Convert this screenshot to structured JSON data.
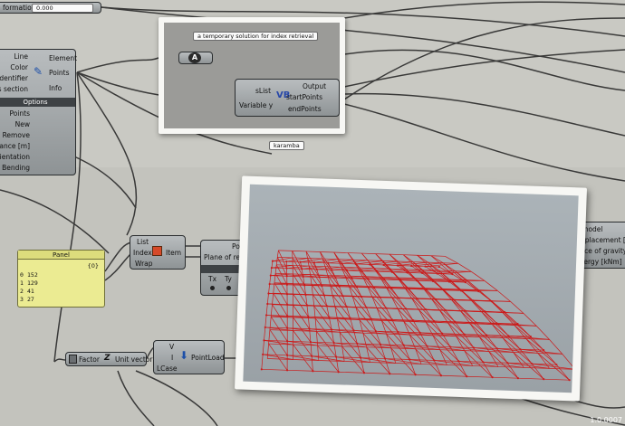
{
  "colors": {
    "canvas": "#c9c9c3",
    "component": "#9a9ea0",
    "panel": "#ebeb92",
    "truss": "#cc1a1a"
  },
  "top_left": {
    "label_cut": "formation",
    "slider_value": "0.000"
  },
  "beam_component": {
    "inputs": [
      "Line",
      "Color",
      "Identifier",
      "oss section"
    ],
    "outputs": [
      "Element",
      "Points",
      "Info"
    ],
    "icon": "pen-icon",
    "options_header": "Options",
    "options": [
      "Points",
      "New",
      "Remove",
      "istance [m]",
      "Orientation",
      "Bending"
    ]
  },
  "scribble_note": {
    "title": "a temporary solution for index retrieval",
    "a_icon": "A",
    "vb": {
      "inputs": [
        "sList",
        "Variable y"
      ],
      "outputs": [
        "Output",
        "startPoints",
        "endPoints"
      ],
      "icon": "vb-script-icon"
    }
  },
  "group_label": "karamba",
  "yellow_panel": {
    "title": "Panel",
    "path": "{0}",
    "rows": [
      {
        "index": "0",
        "value": "152"
      },
      {
        "index": "1",
        "value": "129"
      },
      {
        "index": "2",
        "value": "41"
      },
      {
        "index": "3",
        "value": "27"
      }
    ]
  },
  "list_item": {
    "inputs": [
      "List",
      "Index",
      "Wrap"
    ],
    "output": "Item",
    "icon": "list-item-icon"
  },
  "pos_component": {
    "title_cut": "Pos",
    "input_cut": "Plane of refere",
    "header_cut": "Co",
    "cols": [
      "Tx",
      "Ty",
      "T"
    ]
  },
  "right_partial": {
    "lines": [
      "d model",
      "displacement [cr",
      "force of gravity [k",
      "energy [kNm]"
    ]
  },
  "load": {
    "factor_label": "Factor",
    "unit_vector": "Unit vector",
    "inputs": [
      "V",
      "I",
      "LCase"
    ],
    "output": "PointLoad"
  },
  "status_value": "1.0.0007"
}
